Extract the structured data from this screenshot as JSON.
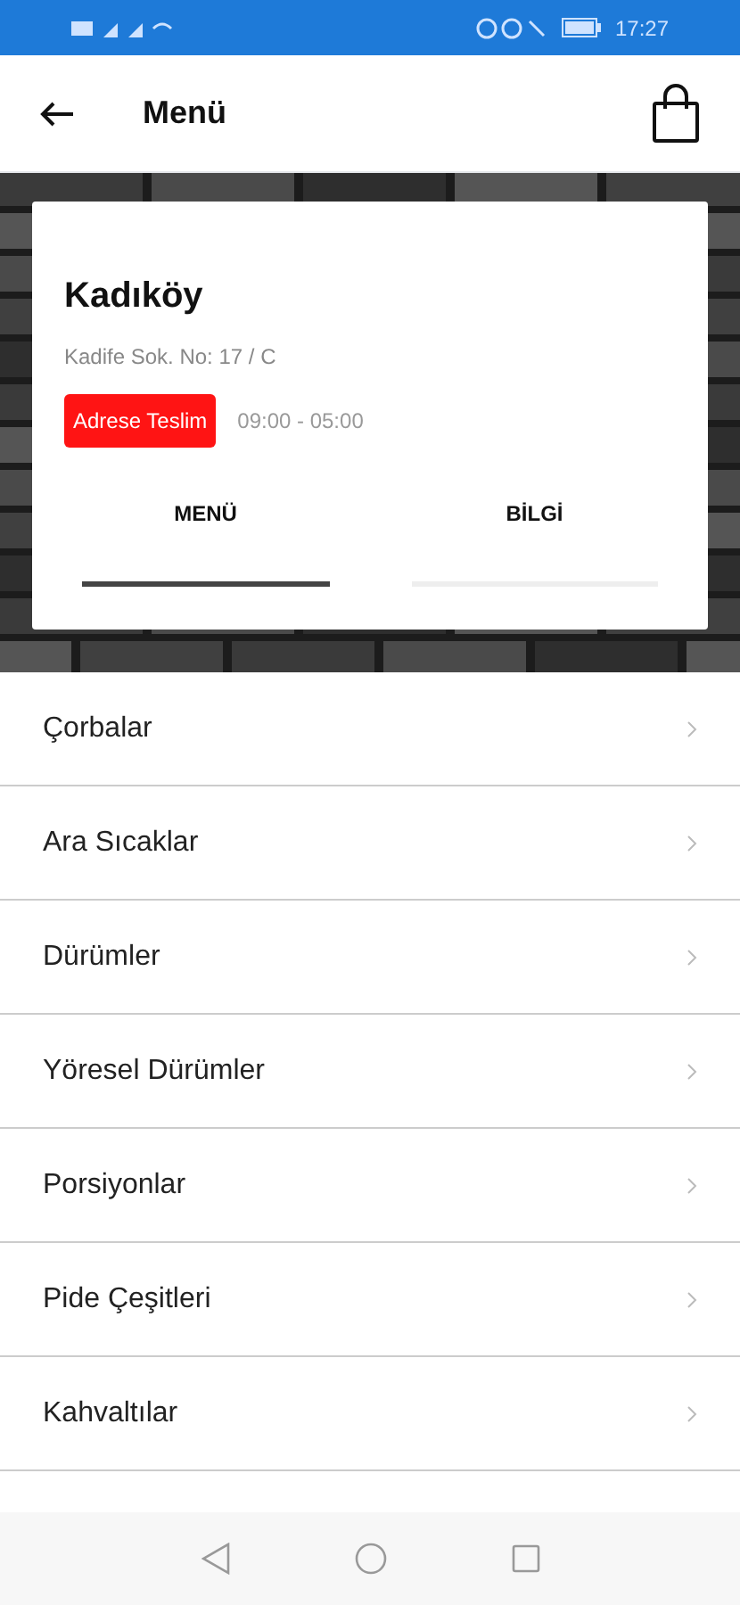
{
  "status_bar": {
    "time": "17:27"
  },
  "header": {
    "title": "Menü"
  },
  "restaurant": {
    "name": "Kadıköy",
    "address": "Kadife Sok. No: 17 / C",
    "delivery_badge": "Adrese Teslim",
    "hours": "09:00 - 05:00"
  },
  "tabs": [
    {
      "label": "MENÜ",
      "selected": true
    },
    {
      "label": "BİLGİ",
      "selected": false
    }
  ],
  "categories": [
    {
      "label": "Çorbalar"
    },
    {
      "label": "Ara Sıcaklar"
    },
    {
      "label": "Dürümler"
    },
    {
      "label": "Yöresel Dürümler"
    },
    {
      "label": "Porsiyonlar"
    },
    {
      "label": "Pide Çeşitleri"
    },
    {
      "label": "Kahvaltılar"
    }
  ]
}
